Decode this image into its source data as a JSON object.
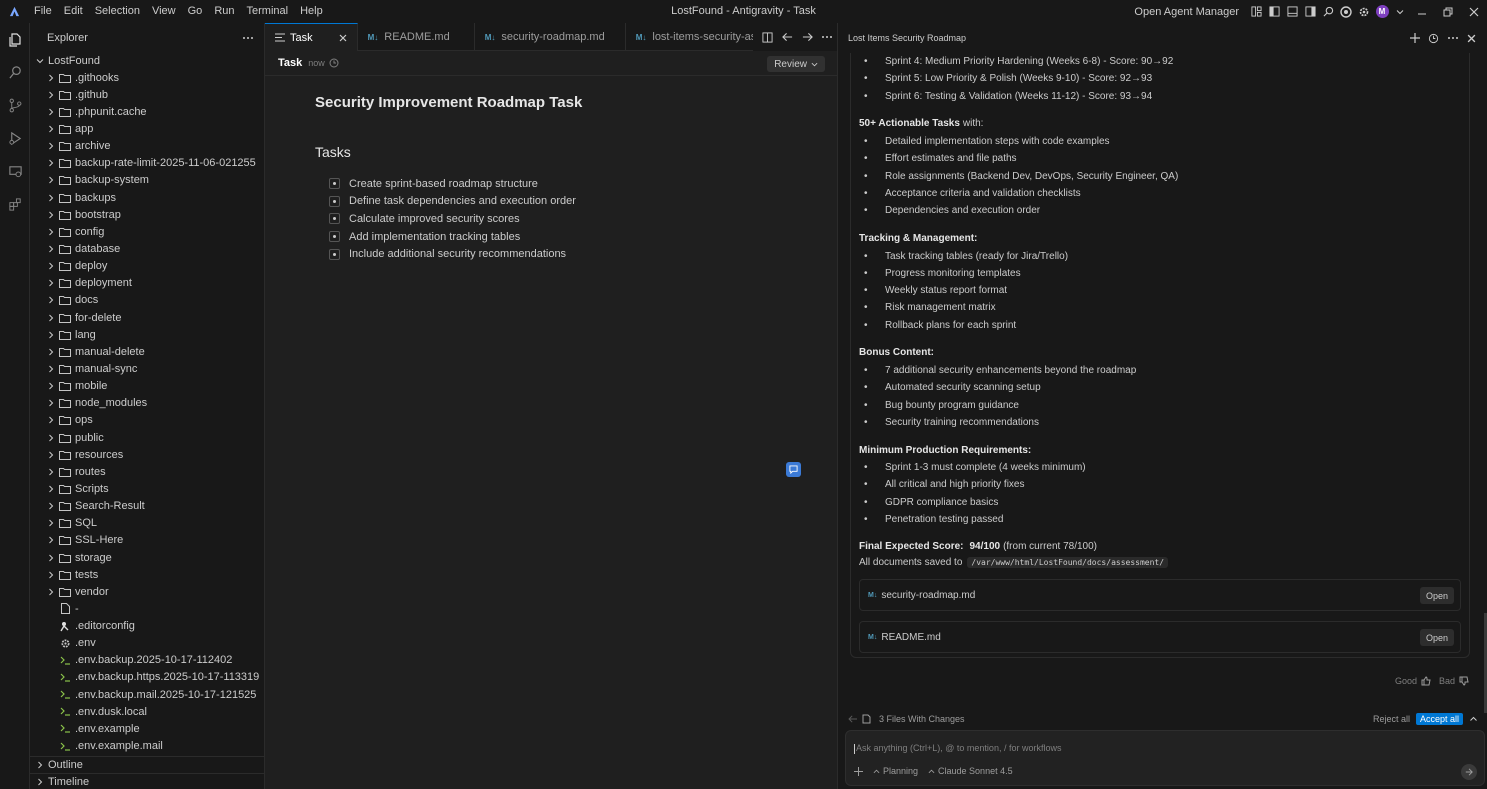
{
  "menu": [
    "File",
    "Edit",
    "Selection",
    "View",
    "Go",
    "Run",
    "Terminal",
    "Help"
  ],
  "window_title": "LostFound - Antigravity - Task",
  "agent_manager_label": "Open Agent Manager",
  "avatar_initial": "M",
  "explorer": {
    "title": "Explorer",
    "root": "LostFound",
    "items": [
      {
        "name": ".githooks",
        "kind": "folder"
      },
      {
        "name": ".github",
        "kind": "folder"
      },
      {
        "name": ".phpunit.cache",
        "kind": "folder"
      },
      {
        "name": "app",
        "kind": "folder"
      },
      {
        "name": "archive",
        "kind": "folder"
      },
      {
        "name": "backup-rate-limit-2025-11-06-021255",
        "kind": "folder"
      },
      {
        "name": "backup-system",
        "kind": "folder"
      },
      {
        "name": "backups",
        "kind": "folder"
      },
      {
        "name": "bootstrap",
        "kind": "folder"
      },
      {
        "name": "config",
        "kind": "folder"
      },
      {
        "name": "database",
        "kind": "folder"
      },
      {
        "name": "deploy",
        "kind": "folder"
      },
      {
        "name": "deployment",
        "kind": "folder"
      },
      {
        "name": "docs",
        "kind": "folder"
      },
      {
        "name": "for-delete",
        "kind": "folder"
      },
      {
        "name": "lang",
        "kind": "folder"
      },
      {
        "name": "manual-delete",
        "kind": "folder"
      },
      {
        "name": "manual-sync",
        "kind": "folder"
      },
      {
        "name": "mobile",
        "kind": "folder"
      },
      {
        "name": "node_modules",
        "kind": "folder"
      },
      {
        "name": "ops",
        "kind": "folder"
      },
      {
        "name": "public",
        "kind": "folder"
      },
      {
        "name": "resources",
        "kind": "folder"
      },
      {
        "name": "routes",
        "kind": "folder"
      },
      {
        "name": "Scripts",
        "kind": "folder"
      },
      {
        "name": "Search-Result",
        "kind": "folder"
      },
      {
        "name": "SQL",
        "kind": "folder"
      },
      {
        "name": "SSL-Here",
        "kind": "folder"
      },
      {
        "name": "storage",
        "kind": "folder"
      },
      {
        "name": "tests",
        "kind": "folder"
      },
      {
        "name": "vendor",
        "kind": "folder"
      },
      {
        "name": "-",
        "kind": "file"
      },
      {
        "name": ".editorconfig",
        "kind": "config"
      },
      {
        "name": ".env",
        "kind": "gear"
      },
      {
        "name": ".env.backup.2025-10-17-112402",
        "kind": "shell"
      },
      {
        "name": ".env.backup.https.2025-10-17-113319",
        "kind": "shell"
      },
      {
        "name": ".env.backup.mail.2025-10-17-121525",
        "kind": "shell"
      },
      {
        "name": ".env.dusk.local",
        "kind": "shell"
      },
      {
        "name": ".env.example",
        "kind": "shell"
      },
      {
        "name": ".env.example.mail",
        "kind": "shell"
      }
    ],
    "outline": "Outline",
    "timeline": "Timeline"
  },
  "tabs": [
    {
      "label": "Task",
      "icon": "list",
      "active": true
    },
    {
      "label": "README.md",
      "icon": "md",
      "active": false
    },
    {
      "label": "security-roadmap.md",
      "icon": "md",
      "active": false
    },
    {
      "label": "lost-items-security-assess",
      "icon": "md",
      "active": false
    }
  ],
  "md_badge": "M↓",
  "crumb": {
    "name": "Task",
    "time": "now",
    "review": "Review"
  },
  "doc": {
    "title": "Security Improvement Roadmap Task",
    "subtitle": "Tasks",
    "tasks": [
      "Create sprint-based roadmap structure",
      "Define task dependencies and execution order",
      "Calculate improved security scores",
      "Add implementation tracking tables",
      "Include additional security recommendations"
    ]
  },
  "agent": {
    "title": "Lost Items Security Roadmap",
    "sprints": [
      "Sprint 4: Medium Priority Hardening (Weeks 6-8) - Score: 90→92",
      "Sprint 5: Low Priority & Polish (Weeks 9-10) - Score: 92→93",
      "Sprint 6: Testing & Validation (Weeks 11-12) - Score: 93→94"
    ],
    "sections": [
      {
        "title": "50+ Actionable Tasks",
        "rest": "with:",
        "items": [
          "Detailed implementation steps with code examples",
          "Effort estimates and file paths",
          "Role assignments (Backend Dev, DevOps, Security Engineer, QA)",
          "Acceptance criteria and validation checklists",
          "Dependencies and execution order"
        ]
      },
      {
        "title": "Tracking & Management:",
        "rest": "",
        "items": [
          "Task tracking tables (ready for Jira/Trello)",
          "Progress monitoring templates",
          "Weekly status report format",
          "Risk management matrix",
          "Rollback plans for each sprint"
        ]
      },
      {
        "title": "Bonus Content:",
        "rest": "",
        "items": [
          "7 additional security enhancements beyond the roadmap",
          "Automated security scanning setup",
          "Bug bounty program guidance",
          "Security training recommendations"
        ]
      },
      {
        "title": "Minimum Production Requirements:",
        "rest": "",
        "items": [
          "Sprint 1-3 must complete (4 weeks minimum)",
          "All critical and high priority fixes",
          "GDPR compliance basics",
          "Penetration testing passed"
        ]
      }
    ],
    "final_label": "Final Expected Score:",
    "final_score": "94/100",
    "final_rest": "(from current 78/100)",
    "saved_text": "All documents saved to",
    "saved_path": "/var/www/html/LostFound/docs/assessment/",
    "files": [
      {
        "name": "security-roadmap.md",
        "action": "Open"
      },
      {
        "name": "README.md",
        "action": "Open"
      }
    ],
    "feedback_good": "Good",
    "feedback_bad": "Bad",
    "changes_label": "3 Files With Changes",
    "reject_all": "Reject all",
    "accept_all": "Accept all",
    "chat_placeholder": "Ask anything (Ctrl+L), @ to mention, / for workflows",
    "mode": "Planning",
    "model": "Claude Sonnet 4.5"
  }
}
